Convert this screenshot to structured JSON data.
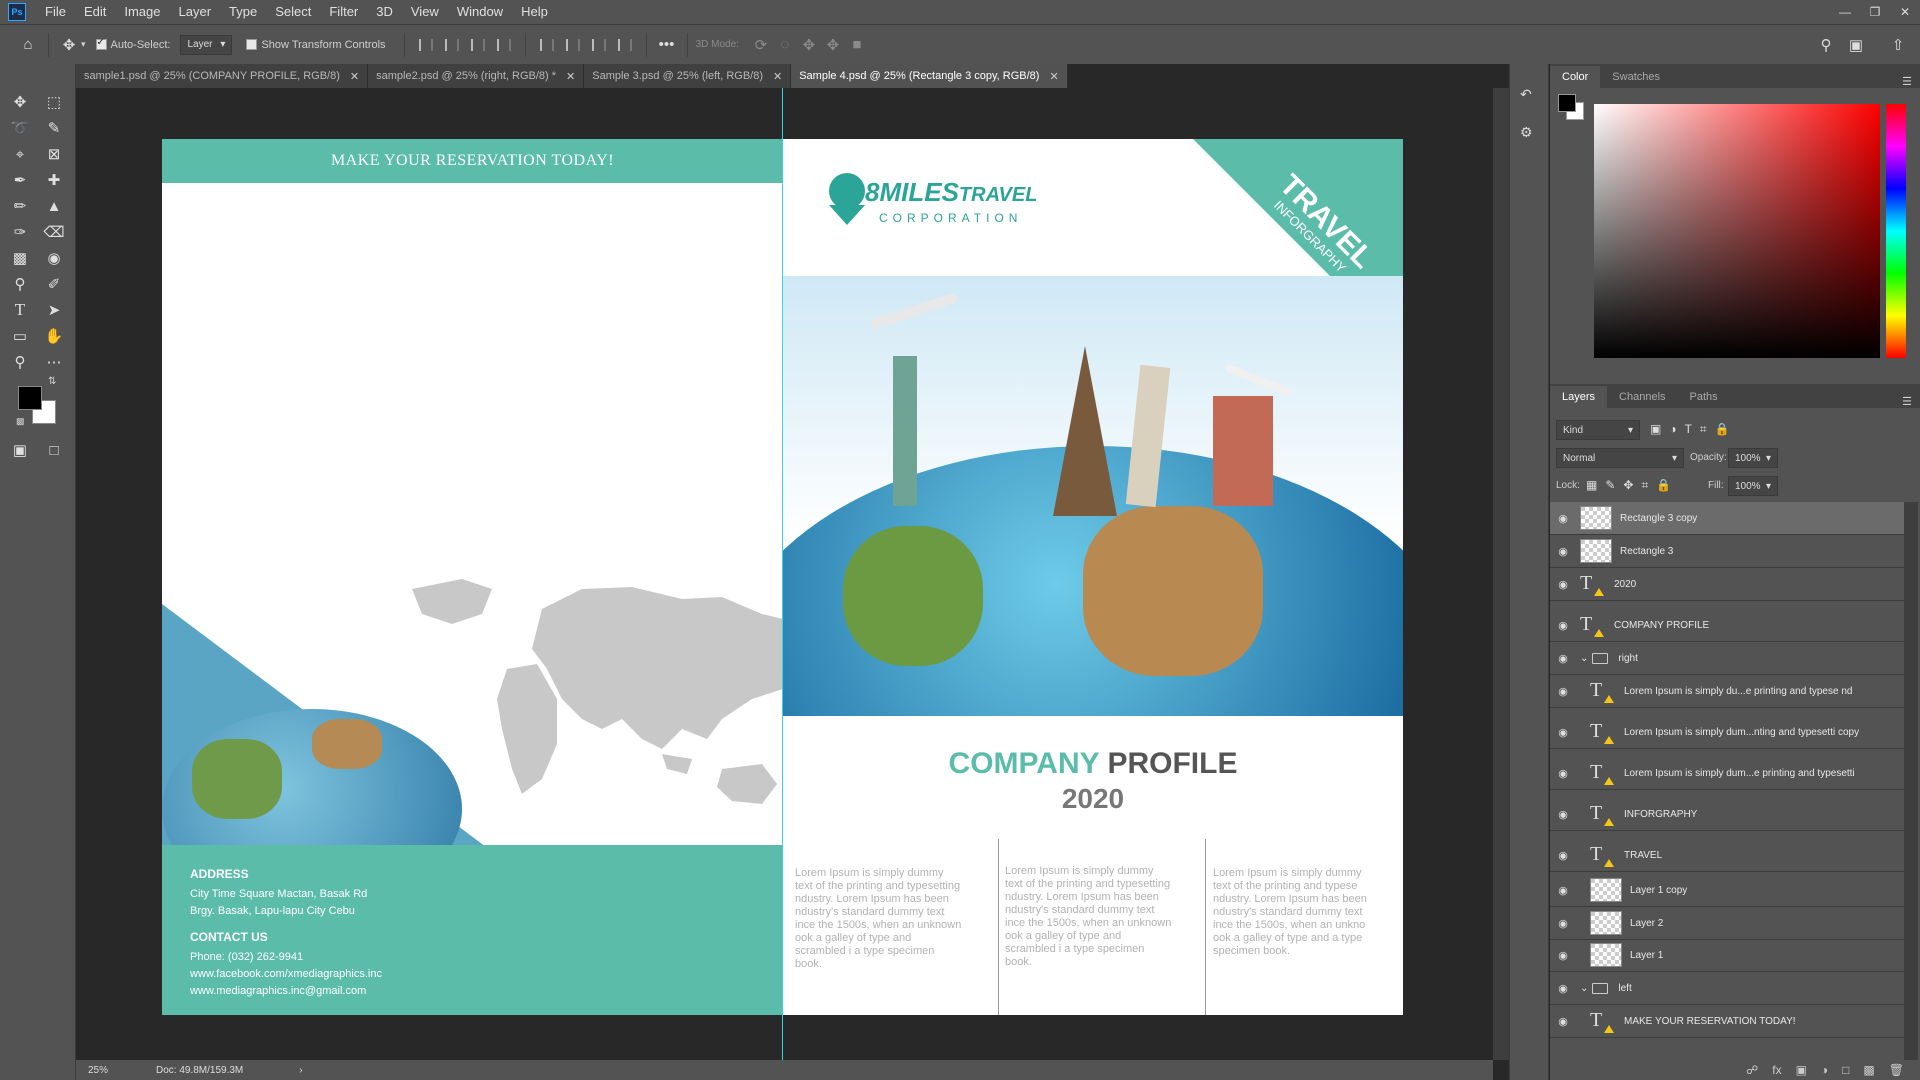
{
  "menubar": {
    "logo": "Ps",
    "items": [
      "File",
      "Edit",
      "Image",
      "Layer",
      "Type",
      "Select",
      "Filter",
      "3D",
      "View",
      "Window",
      "Help"
    ]
  },
  "options": {
    "auto_select_label": "Auto-Select:",
    "auto_select_target": "Layer",
    "show_transform_label": "Show Transform Controls",
    "mode_3d_label": "3D Mode:",
    "more": "•••"
  },
  "tabs": [
    {
      "label": "sample1.psd @ 25% (COMPANY PROFILE, RGB/8)",
      "active": false
    },
    {
      "label": "sample2.psd @ 25% (right, RGB/8) *",
      "active": false
    },
    {
      "label": "Sample 3.psd @ 25% (left, RGB/8)",
      "active": false
    },
    {
      "label": "Sample 4.psd @ 25% (Rectangle 3 copy, RGB/8)",
      "active": true
    }
  ],
  "status": {
    "zoom": "25%",
    "doc": "Doc: 49.8M/159.3M"
  },
  "color_panel": {
    "tabs": [
      "Color",
      "Swatches"
    ],
    "foreground": "#000000",
    "background": "#ffffff",
    "hue_color": "#ff0000"
  },
  "layers_panel": {
    "tabs": [
      "Layers",
      "Channels",
      "Paths"
    ],
    "filter_kind": "Kind",
    "blend_mode": "Normal",
    "opacity_label": "Opacity:",
    "opacity_value": "100%",
    "lock_label": "Lock:",
    "fill_label": "Fill:",
    "fill_value": "100%",
    "layers": [
      {
        "name": "Rectangle 3 copy",
        "kind": "pixel",
        "selected": true,
        "indent": 0
      },
      {
        "name": "Rectangle 3",
        "kind": "pixel",
        "selected": false,
        "indent": 0
      },
      {
        "name": "2020",
        "kind": "text",
        "selected": false,
        "indent": 0
      },
      {
        "name": "COMPANY PROFILE",
        "kind": "text",
        "selected": false,
        "indent": 0
      },
      {
        "name": "right",
        "kind": "group",
        "selected": false,
        "indent": 0
      },
      {
        "name": "Lorem Ipsum is simply du...e printing and typese nd",
        "kind": "text",
        "selected": false,
        "indent": 1
      },
      {
        "name": "Lorem Ipsum is simply dum...nting and typesetti copy",
        "kind": "text",
        "selected": false,
        "indent": 1
      },
      {
        "name": "Lorem Ipsum is simply dum...e printing and typesetti",
        "kind": "text",
        "selected": false,
        "indent": 1
      },
      {
        "name": "INFORGRAPHY",
        "kind": "text",
        "selected": false,
        "indent": 1
      },
      {
        "name": "TRAVEL",
        "kind": "text",
        "selected": false,
        "indent": 1
      },
      {
        "name": "Layer 1 copy",
        "kind": "pixel",
        "selected": false,
        "indent": 1
      },
      {
        "name": "Layer 2",
        "kind": "pixel",
        "selected": false,
        "indent": 1
      },
      {
        "name": "Layer 1",
        "kind": "pixel",
        "selected": false,
        "indent": 1
      },
      {
        "name": "left",
        "kind": "group",
        "selected": false,
        "indent": 0
      },
      {
        "name": "MAKE YOUR RESERVATION TODAY!",
        "kind": "text",
        "selected": false,
        "indent": 1
      }
    ]
  },
  "document": {
    "left": {
      "banner": "MAKE YOUR RESERVATION TODAY!",
      "address_heading": "ADDRESS",
      "address_line1": "City Time Square Mactan, Basak Rd",
      "address_line2": "Brgy. Basak, Lapu-lapu City Cebu",
      "contact_heading": "CONTACT US",
      "phone": "Phone: (032) 262-9941",
      "facebook": "www.facebook.com/xmediagraphics.inc",
      "email": "www.mediagraphics.inc@gmail.com"
    },
    "right": {
      "logo_main": "8MILES",
      "logo_travel": "TRAVEL",
      "logo_sub": "CORPORATION",
      "corner_title": "TRAVEL",
      "corner_sub": "INFORGRAPHY",
      "title_accent": "COMPANY",
      "title_rest": "PROFILE",
      "year": "2020",
      "columns": [
        "Lorem Ipsum is simply dummy text of the printing and typesetting ndustry. Lorem Ipsum has been ndustry's standard dummy text ince the 1500s, when an unknown ook a galley of type and scrambled i a type specimen book.",
        "Lorem Ipsum is simply dummy text of the printing and typesetting ndustry. Lorem Ipsum has been ndustry's standard dummy text ince the 1500s, when an unknown ook a galley of type and scrambled i a type specimen book.",
        "Lorem Ipsum is simply dummy text of the printing and typese ndustry. Lorem Ipsum has been ndustry's standard dummy text ince the 1500s, when an unkno ook a galley of type and a type specimen book."
      ]
    },
    "accent": "#5bbcaa"
  }
}
